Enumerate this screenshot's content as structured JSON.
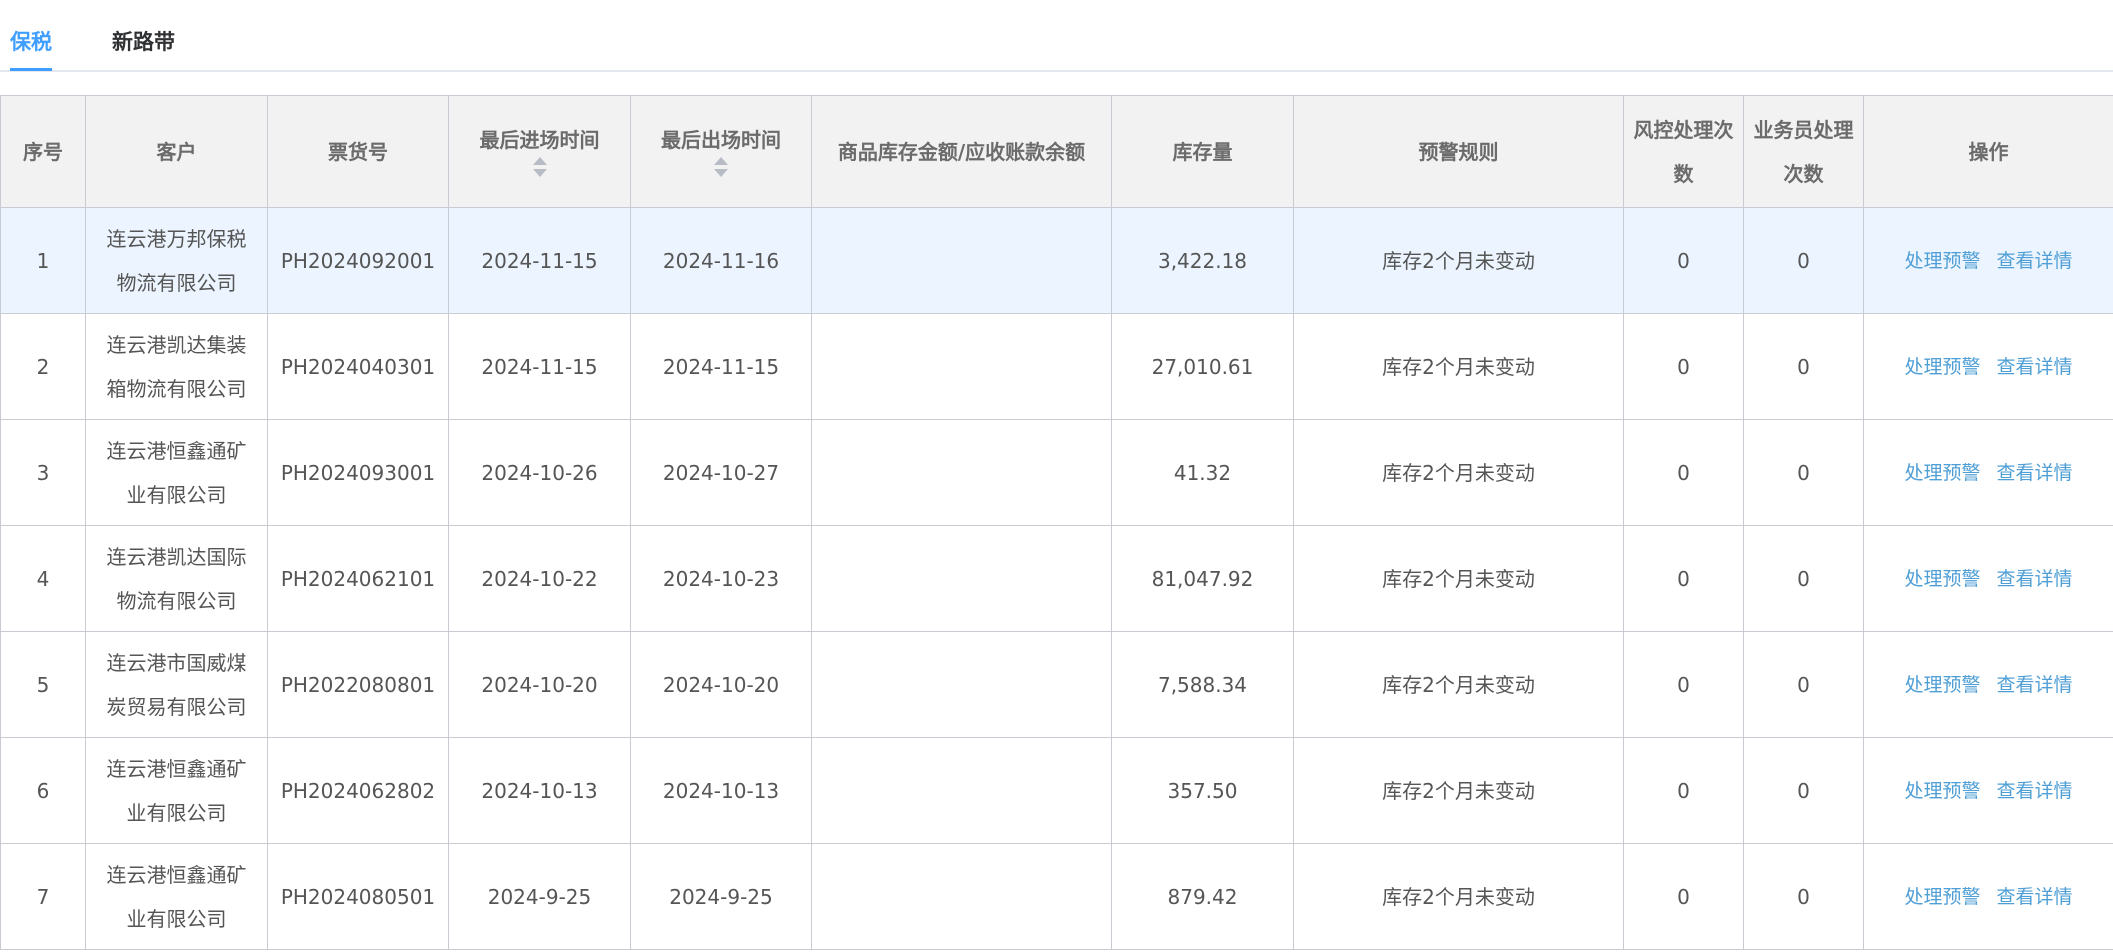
{
  "tabs": [
    {
      "label": "保税",
      "active": true
    },
    {
      "label": "新路带",
      "active": false
    }
  ],
  "table": {
    "headers": {
      "index": "序号",
      "customer": "客户",
      "ticket_no": "票货号",
      "last_in_time": "最后进场时间",
      "last_out_time": "最后出场时间",
      "amount": "商品库存金额/应收账款余额",
      "stock_qty": "库存量",
      "warning_rule": "预警规则",
      "risk_count": "风控处理次数",
      "staff_count": "业务员处理次数",
      "actions": "操作"
    },
    "action_labels": {
      "handle": "处理预警",
      "detail": "查看详情"
    },
    "rows": [
      {
        "index": "1",
        "customer": "连云港万邦保税物流有限公司",
        "ticket_no": "PH2024092001",
        "last_in_time": "2024-11-15",
        "last_out_time": "2024-11-16",
        "amount": "",
        "stock_qty": "3,422.18",
        "warning_rule": "库存2个月未变动",
        "risk_count": "0",
        "staff_count": "0"
      },
      {
        "index": "2",
        "customer": "连云港凯达集装箱物流有限公司",
        "ticket_no": "PH2024040301",
        "last_in_time": "2024-11-15",
        "last_out_time": "2024-11-15",
        "amount": "",
        "stock_qty": "27,010.61",
        "warning_rule": "库存2个月未变动",
        "risk_count": "0",
        "staff_count": "0"
      },
      {
        "index": "3",
        "customer": "连云港恒鑫通矿业有限公司",
        "ticket_no": "PH2024093001",
        "last_in_time": "2024-10-26",
        "last_out_time": "2024-10-27",
        "amount": "",
        "stock_qty": "41.32",
        "warning_rule": "库存2个月未变动",
        "risk_count": "0",
        "staff_count": "0"
      },
      {
        "index": "4",
        "customer": "连云港凯达国际物流有限公司",
        "ticket_no": "PH2024062101",
        "last_in_time": "2024-10-22",
        "last_out_time": "2024-10-23",
        "amount": "",
        "stock_qty": "81,047.92",
        "warning_rule": "库存2个月未变动",
        "risk_count": "0",
        "staff_count": "0"
      },
      {
        "index": "5",
        "customer": "连云港市国威煤炭贸易有限公司",
        "ticket_no": "PH2022080801",
        "last_in_time": "2024-10-20",
        "last_out_time": "2024-10-20",
        "amount": "",
        "stock_qty": "7,588.34",
        "warning_rule": "库存2个月未变动",
        "risk_count": "0",
        "staff_count": "0"
      },
      {
        "index": "6",
        "customer": "连云港恒鑫通矿业有限公司",
        "ticket_no": "PH2024062802",
        "last_in_time": "2024-10-13",
        "last_out_time": "2024-10-13",
        "amount": "",
        "stock_qty": "357.50",
        "warning_rule": "库存2个月未变动",
        "risk_count": "0",
        "staff_count": "0"
      },
      {
        "index": "7",
        "customer": "连云港恒鑫通矿业有限公司",
        "ticket_no": "PH2024080501",
        "last_in_time": "2024-9-25",
        "last_out_time": "2024-9-25",
        "amount": "",
        "stock_qty": "879.42",
        "warning_rule": "库存2个月未变动",
        "risk_count": "0",
        "staff_count": "0"
      }
    ]
  },
  "colors": {
    "accent": "#409eff",
    "link": "#4f9fd6",
    "header_bg": "#f2f2f2",
    "highlight_row_bg": "#ecf5ff",
    "border": "#c8ccd2"
  }
}
